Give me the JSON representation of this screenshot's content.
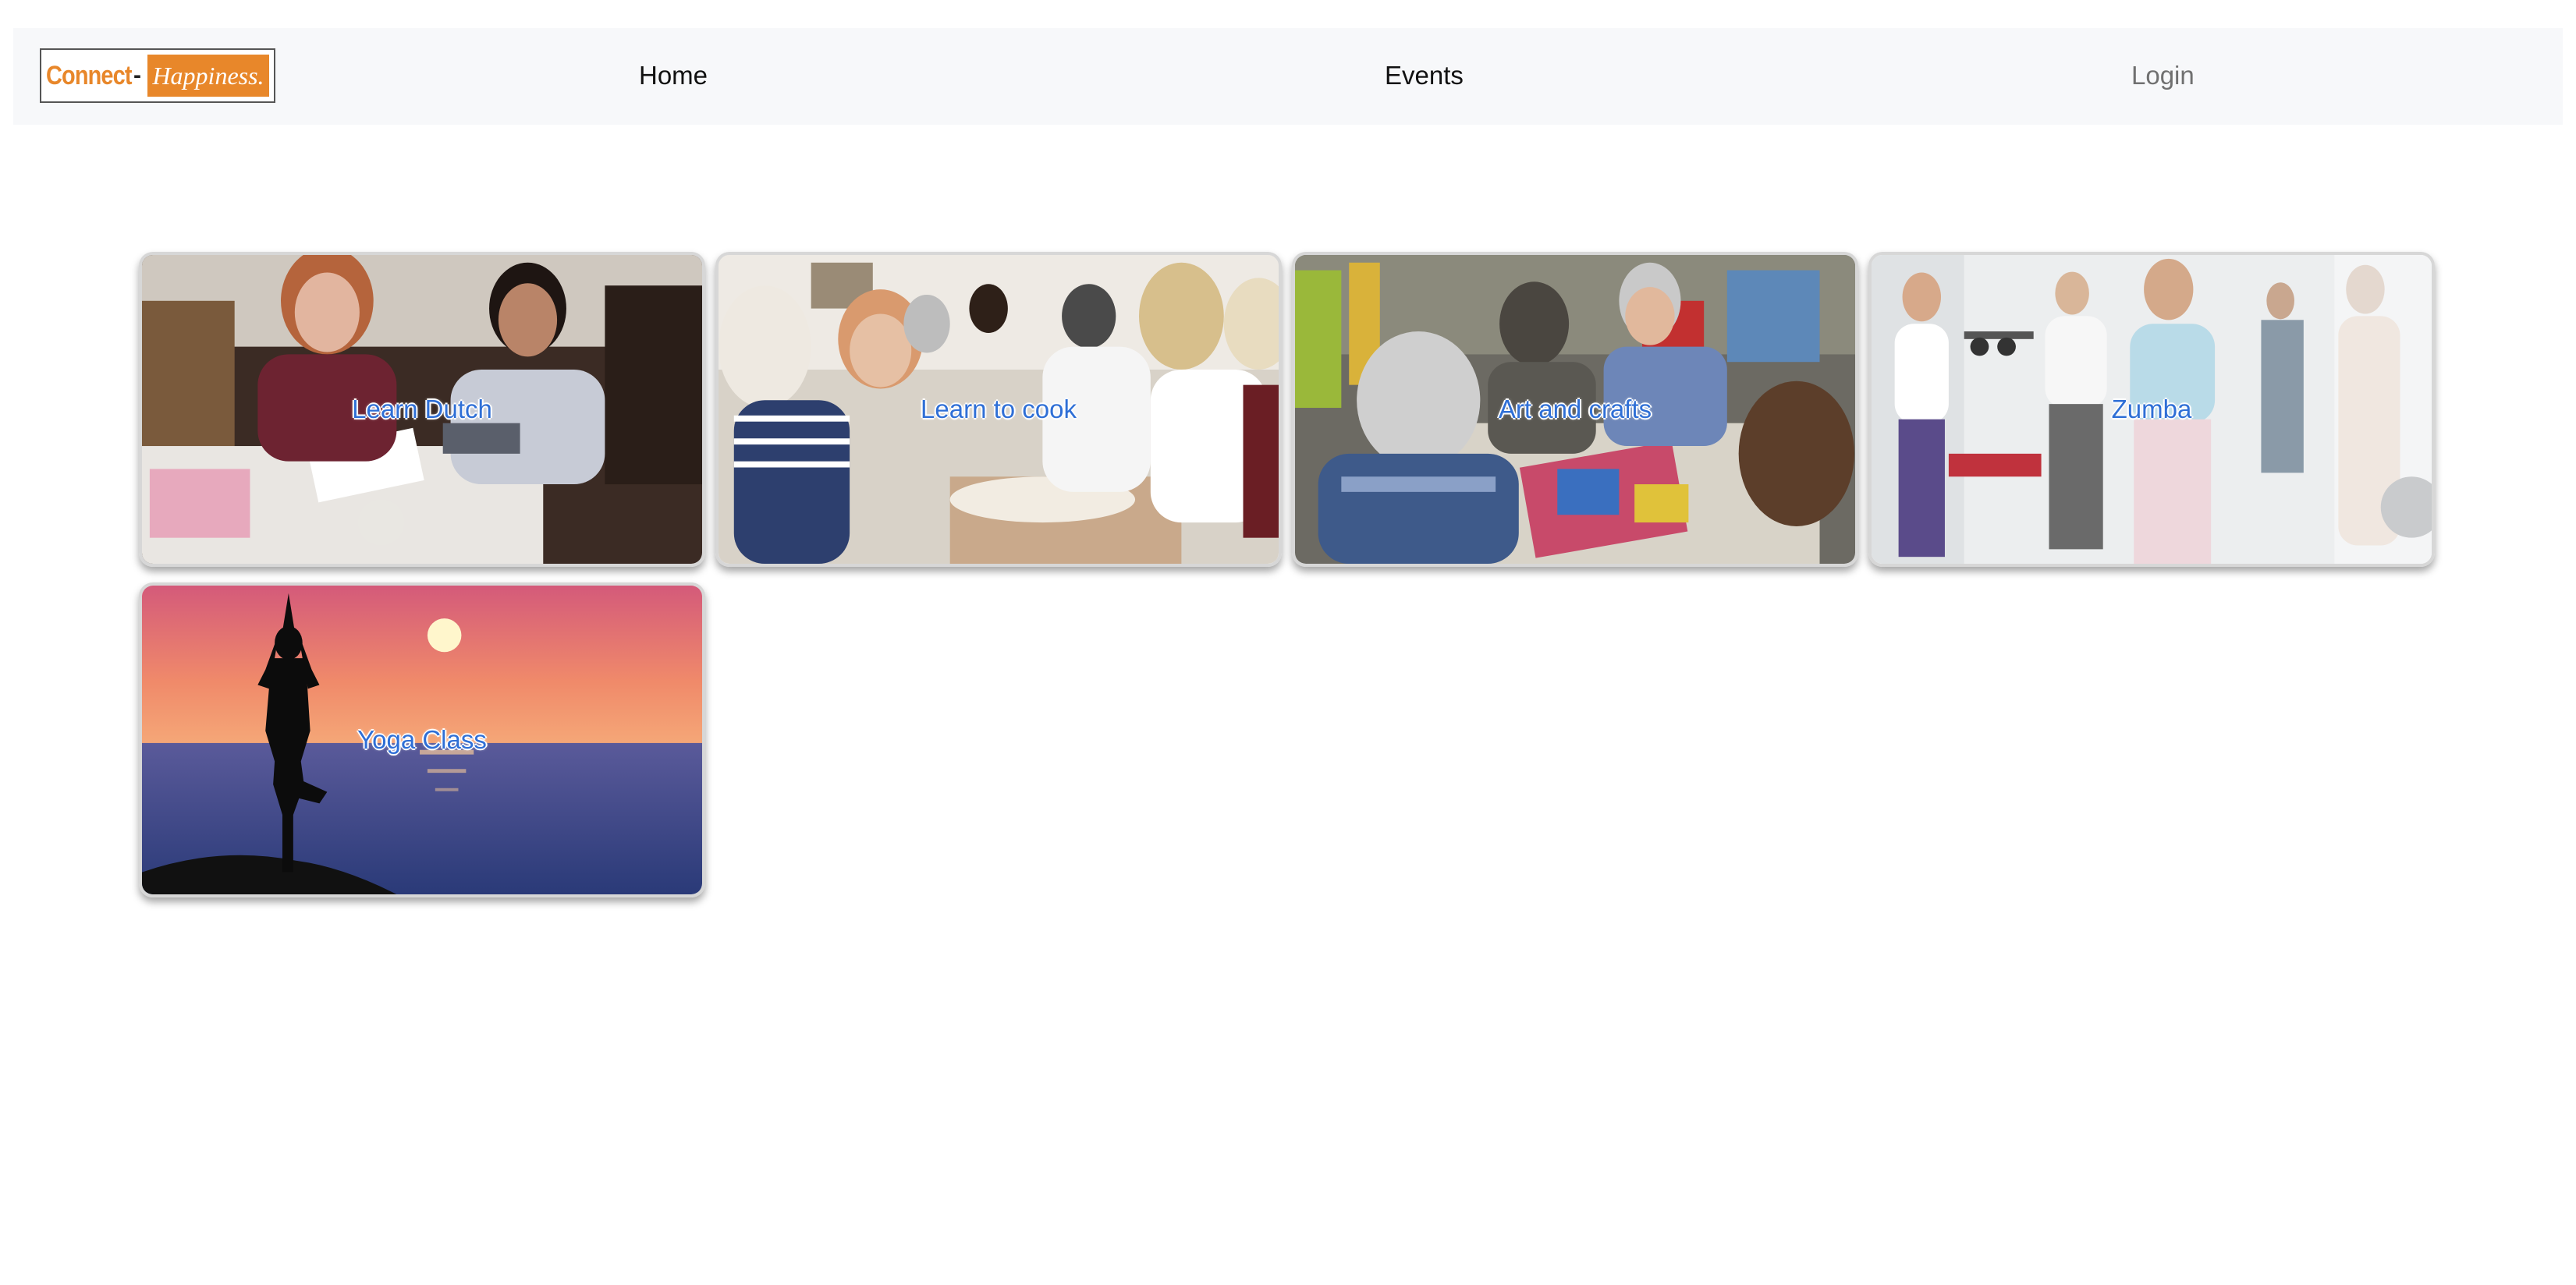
{
  "navbar": {
    "logo": {
      "left_text": "Connect",
      "dash": "-",
      "right_text": "Happiness."
    },
    "links": [
      {
        "label": "Home"
      },
      {
        "label": "Events"
      },
      {
        "label": "Login"
      }
    ]
  },
  "cards": [
    {
      "title": "Learn Dutch"
    },
    {
      "title": "Learn to cook"
    },
    {
      "title": "Art and crafts"
    },
    {
      "title": "Zumba"
    },
    {
      "title": "Yoga Class"
    }
  ],
  "colors": {
    "brand_orange": "#e8872a",
    "card_title": "#2f6fd6",
    "navbar_bg": "#f7f8fa"
  }
}
